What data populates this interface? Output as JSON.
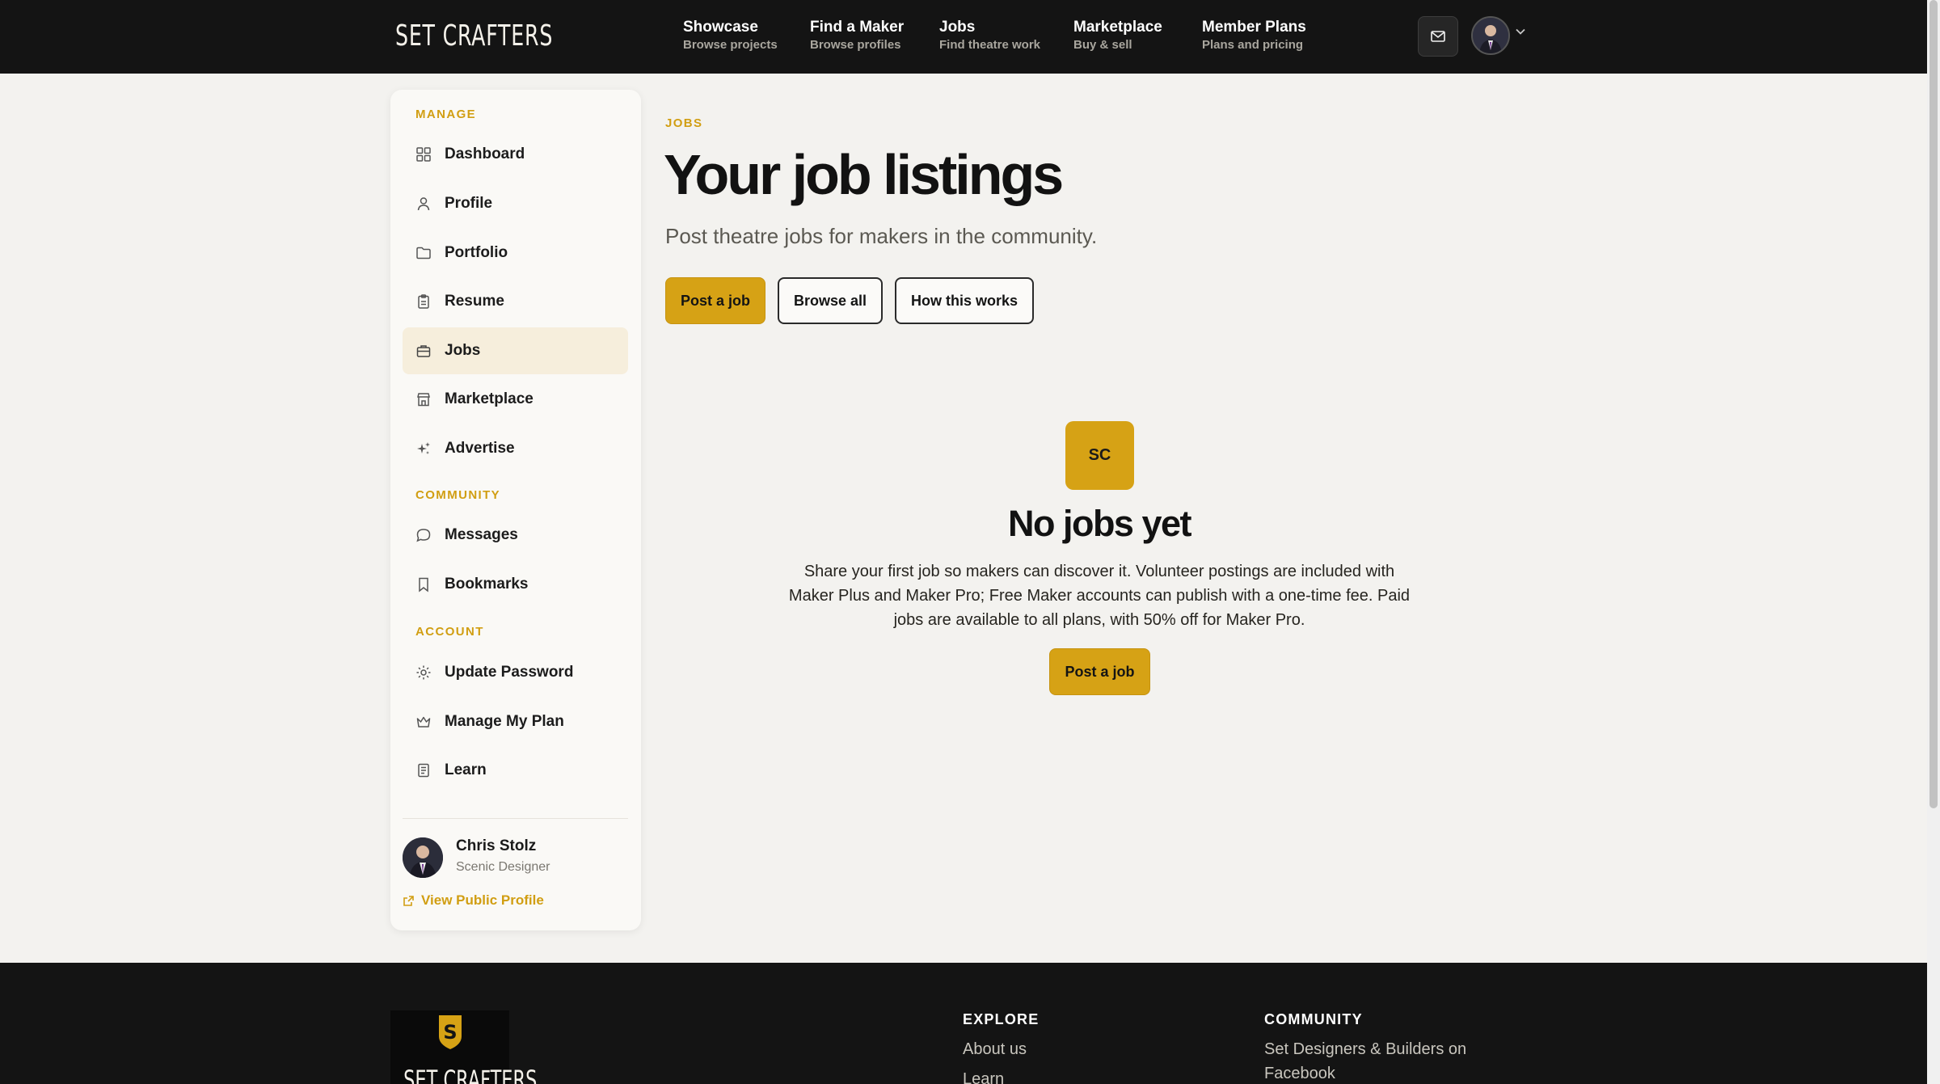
{
  "brand": {
    "name": "SET CRAFTERS",
    "accent": "#d6a215"
  },
  "nav": [
    {
      "title": "Showcase",
      "sub": "Browse projects"
    },
    {
      "title": "Find a Maker",
      "sub": "Browse profiles"
    },
    {
      "title": "Jobs",
      "sub": "Find theatre work"
    },
    {
      "title": "Marketplace",
      "sub": "Buy & sell"
    },
    {
      "title": "Member Plans",
      "sub": "Plans and pricing"
    }
  ],
  "sidebar": {
    "sections": {
      "manage": "MANAGE",
      "community": "COMMUNITY",
      "account": "ACCOUNT"
    },
    "items": {
      "dashboard": "Dashboard",
      "profile": "Profile",
      "portfolio": "Portfolio",
      "resume": "Resume",
      "jobs": "Jobs",
      "marketplace": "Marketplace",
      "advertise": "Advertise",
      "messages": "Messages",
      "bookmarks": "Bookmarks",
      "update_password": "Update Password",
      "manage_plan": "Manage My Plan",
      "learn": "Learn"
    },
    "active": "Jobs",
    "user": {
      "name": "Chris Stolz",
      "role": "Scenic Designer",
      "public_link": "View Public Profile"
    }
  },
  "main": {
    "eyebrow": "JOBS",
    "title": "Your job listings",
    "lead": "Post theatre jobs for makers in the community.",
    "buttons": {
      "post": "Post a job",
      "browse": "Browse all",
      "how": "How this works"
    },
    "empty": {
      "badge": "SC",
      "title": "No jobs yet",
      "text": "Share your first job so makers can discover it. Volunteer postings are included with Maker Plus and Maker Pro; Free Maker accounts can publish with a one-time fee. Paid jobs are available to all plans, with 50% off for Maker Pro.",
      "cta": "Post a job"
    }
  },
  "footer": {
    "logo_text": "SET CRAFTERS",
    "explore_title": "EXPLORE",
    "explore_links": [
      "About us",
      "Learn"
    ],
    "community_title": "COMMUNITY",
    "community_link": "Set Designers & Builders on Facebook"
  }
}
